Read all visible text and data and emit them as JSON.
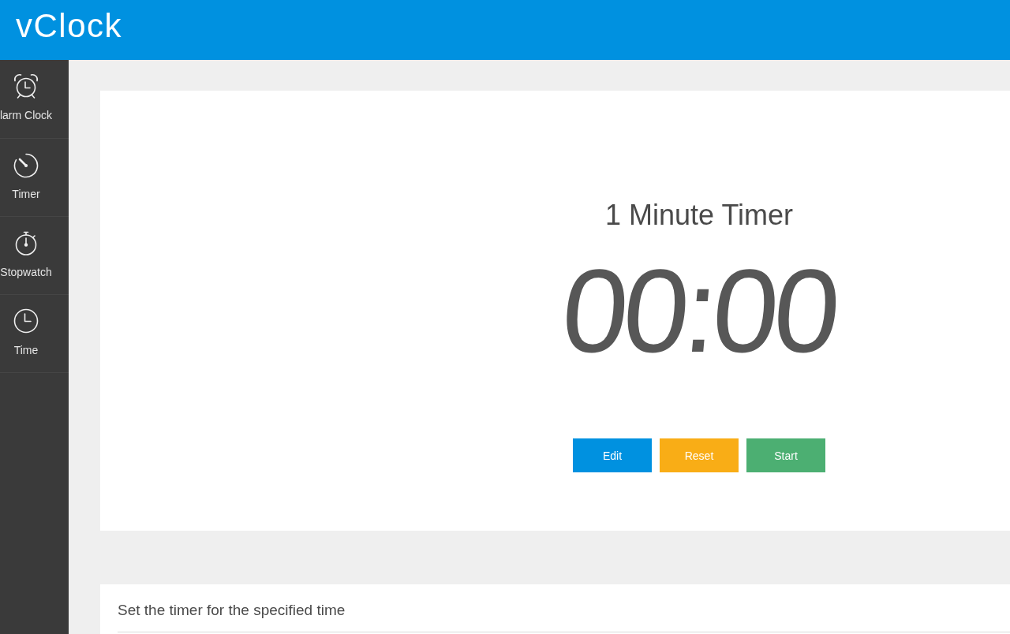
{
  "header": {
    "logo": "vClock"
  },
  "sidebar": {
    "items": [
      {
        "kind": "alarm-clock",
        "label": "larm Clock",
        "selected": false
      },
      {
        "kind": "timer",
        "label": "Timer",
        "selected": false
      },
      {
        "kind": "stopwatch",
        "label": "Stopwatch",
        "selected": false
      },
      {
        "kind": "clock",
        "label": "Time",
        "selected": false
      }
    ]
  },
  "timer_card": {
    "title": "1 Minute Timer",
    "display": "00:00",
    "buttons": [
      {
        "label": "Edit",
        "color": "#0091e0"
      },
      {
        "label": "Reset",
        "color": "#f9ad16"
      },
      {
        "label": "Start",
        "color": "#4caf72"
      }
    ]
  },
  "info_card": {
    "heading": "Set the timer for the specified time"
  }
}
